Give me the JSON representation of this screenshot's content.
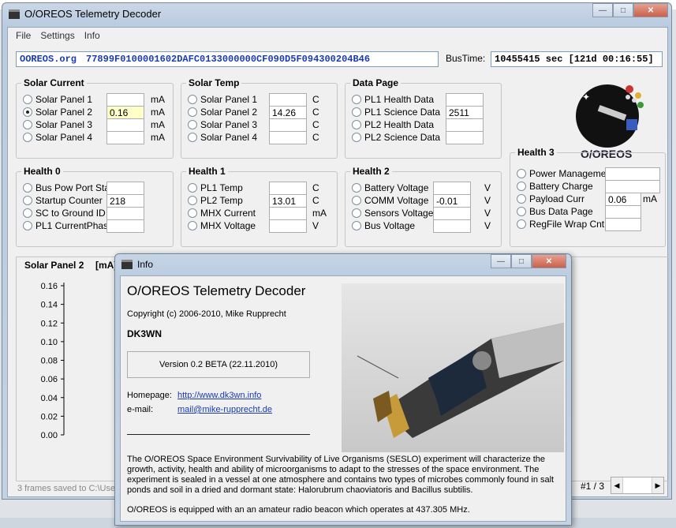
{
  "window": {
    "title": "O/OREOS Telemetry Decoder"
  },
  "menu": [
    "File",
    "Settings",
    "Info"
  ],
  "bus": {
    "source": "OOREOS.org",
    "hex": "77899F0100001602DAFC0133000000CF090D5F094300204B46",
    "time_label": "BusTime:",
    "time_value": "10455415 sec   [121d 00:16:55]"
  },
  "groups": {
    "solar_current": {
      "title": "Solar Current",
      "rows": [
        {
          "label": "Solar Panel 1",
          "value": "",
          "unit": "mA",
          "selected": false
        },
        {
          "label": "Solar Panel 2",
          "value": "0.16",
          "unit": "mA",
          "selected": true
        },
        {
          "label": "Solar Panel 3",
          "value": "",
          "unit": "mA",
          "selected": false
        },
        {
          "label": "Solar Panel 4",
          "value": "",
          "unit": "mA",
          "selected": false
        }
      ]
    },
    "solar_temp": {
      "title": "Solar Temp",
      "rows": [
        {
          "label": "Solar Panel 1",
          "value": "",
          "unit": "C"
        },
        {
          "label": "Solar Panel 2",
          "value": "14.26",
          "unit": "C"
        },
        {
          "label": "Solar Panel 3",
          "value": "",
          "unit": "C"
        },
        {
          "label": "Solar Panel 4",
          "value": "",
          "unit": "C"
        }
      ]
    },
    "data_page": {
      "title": "Data Page",
      "rows": [
        {
          "label": "PL1 Health Data",
          "value": ""
        },
        {
          "label": "PL1 Science Data",
          "value": "2511"
        },
        {
          "label": "PL2 Health Data",
          "value": ""
        },
        {
          "label": "PL2 Science Data",
          "value": ""
        }
      ]
    },
    "health0": {
      "title": "Health 0",
      "rows": [
        {
          "label": "Bus Pow Port Stat",
          "value": ""
        },
        {
          "label": "Startup Counter",
          "value": "218"
        },
        {
          "label": "SC to Ground ID",
          "value": ""
        },
        {
          "label": "PL1 CurrentPhase",
          "value": ""
        }
      ]
    },
    "health1": {
      "title": "Health 1",
      "rows": [
        {
          "label": "PL1 Temp",
          "value": "",
          "unit": "C"
        },
        {
          "label": "PL2 Temp",
          "value": "13.01",
          "unit": "C"
        },
        {
          "label": "MHX Current",
          "value": "",
          "unit": "mA"
        },
        {
          "label": "MHX Voltage",
          "value": "",
          "unit": "V"
        }
      ]
    },
    "health2": {
      "title": "Health 2",
      "rows": [
        {
          "label": "Battery Voltage",
          "value": "",
          "unit": "V"
        },
        {
          "label": "COMM Voltage",
          "value": "-0.01",
          "unit": "V"
        },
        {
          "label": "Sensors Voltage",
          "value": "",
          "unit": "V"
        },
        {
          "label": "Bus Voltage",
          "value": "",
          "unit": "V"
        }
      ]
    },
    "health3": {
      "title": "Health 3",
      "rows": [
        {
          "label": "Power Management",
          "value": "",
          "unit": ""
        },
        {
          "label": "Battery Charge",
          "value": "",
          "unit": ""
        },
        {
          "label": "Payload Curr",
          "value": "0.06",
          "unit": "mA"
        },
        {
          "label": "Bus Data Page",
          "value": "",
          "unit": ""
        },
        {
          "label": "RegFile Wrap Cnt",
          "value": "",
          "unit": ""
        }
      ]
    }
  },
  "logo": {
    "text": "O/OREOS"
  },
  "chart": {
    "title": "Solar Panel 2",
    "unit": "[mA]"
  },
  "chart_data": {
    "type": "line",
    "ylabel": "",
    "ylim": [
      0,
      0.16
    ],
    "yticks": [
      "0.16",
      "0.14",
      "0.12",
      "0.10",
      "0.08",
      "0.06",
      "0.04",
      "0.02",
      "0.00"
    ],
    "series": []
  },
  "status": {
    "text": "3 frames saved to C:\\User",
    "page": "#1 / 3"
  },
  "info": {
    "title": "Info",
    "app_name": "O/OREOS Telemetry Decoder",
    "copyright": "Copyright (c) 2006-2010, Mike Rupprecht",
    "callsign": "DK3WN",
    "version": "Version 0.2 BETA     (22.11.2010)",
    "homepage_label": "Homepage:",
    "homepage": "http://www.dk3wn.info",
    "email_label": "e-mail:",
    "email": "mail@mike-rupprecht.de",
    "description": "The O/OREOS Space Environment Survivability of Live Organisms (SESLO) experiment will characterize the growth, activity, health and ability of microorganisms to adapt to the stresses of the space environment. The experiment is sealed in a vessel at one atmosphere and contains two types of microbes commonly found in salt ponds and soil in a dried and dormant state: Halorubrum chaoviatoris and Bacillus subtilis.",
    "beacon": "O/OREOS is equipped with an an amateur radio beacon which operates at 437.305 MHz."
  }
}
